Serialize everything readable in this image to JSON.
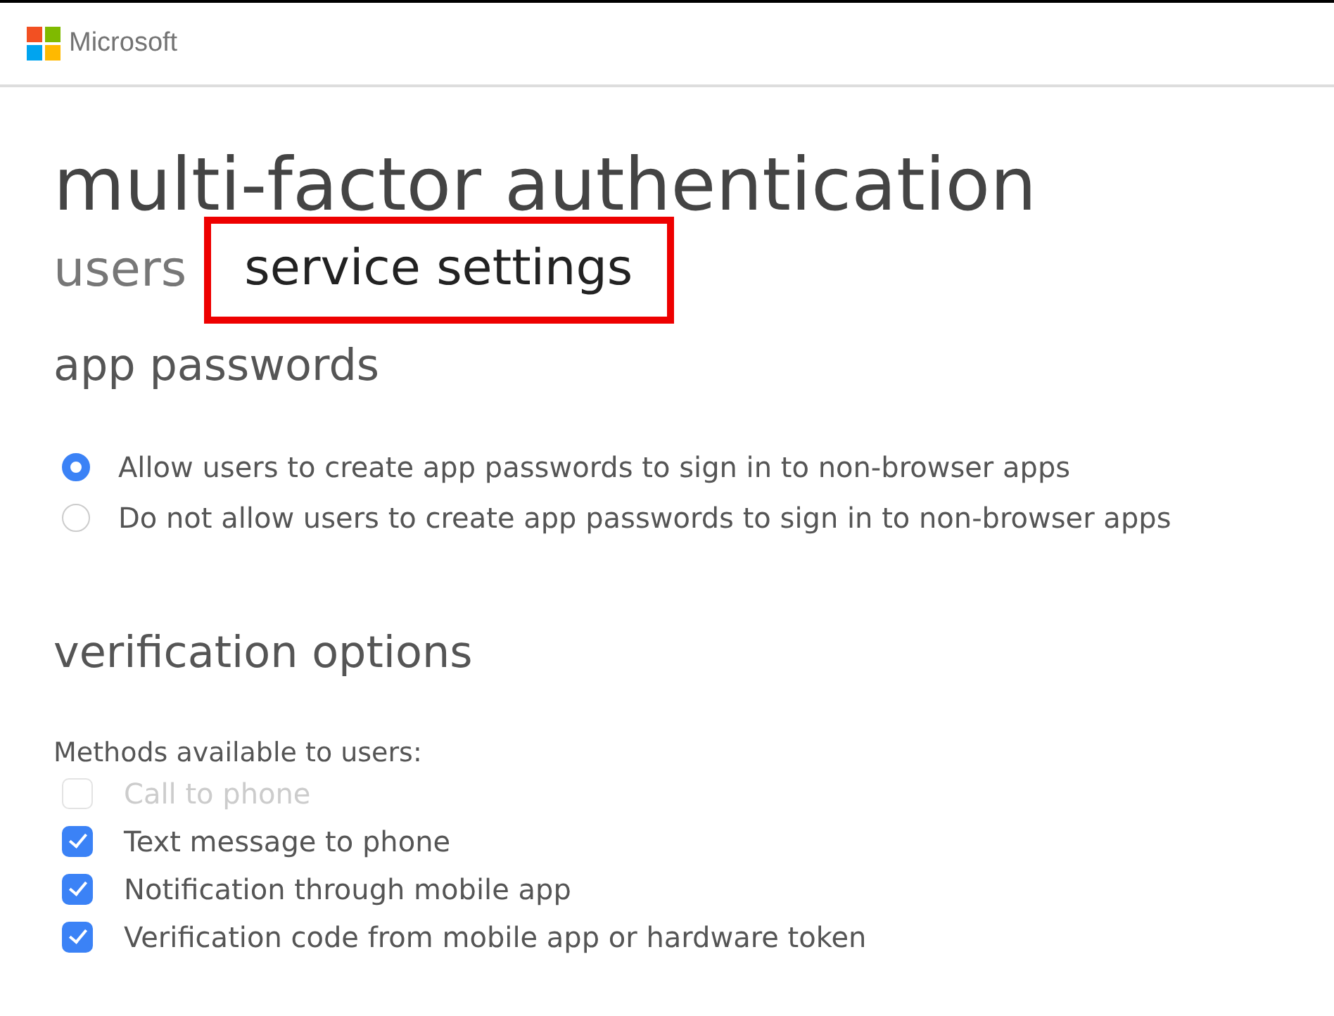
{
  "header": {
    "brand": "Microsoft"
  },
  "title": "multi-factor authentication",
  "tabs": [
    {
      "label": "users",
      "selected": false
    },
    {
      "label": "service settings",
      "selected": true
    }
  ],
  "app_passwords": {
    "heading": "app passwords",
    "options": [
      {
        "label": "Allow users to create app passwords to sign in to non-browser apps",
        "selected": true
      },
      {
        "label": "Do not allow users to create app passwords to sign in to non-browser apps",
        "selected": false
      }
    ]
  },
  "verification_options": {
    "heading": "verification options",
    "label": "Methods available to users:",
    "methods": [
      {
        "label": "Call to phone",
        "checked": false,
        "disabled": true
      },
      {
        "label": "Text message to phone",
        "checked": true,
        "disabled": false
      },
      {
        "label": "Notification through mobile app",
        "checked": true,
        "disabled": false
      },
      {
        "label": "Verification code from mobile app or hardware token",
        "checked": true,
        "disabled": false
      }
    ]
  }
}
